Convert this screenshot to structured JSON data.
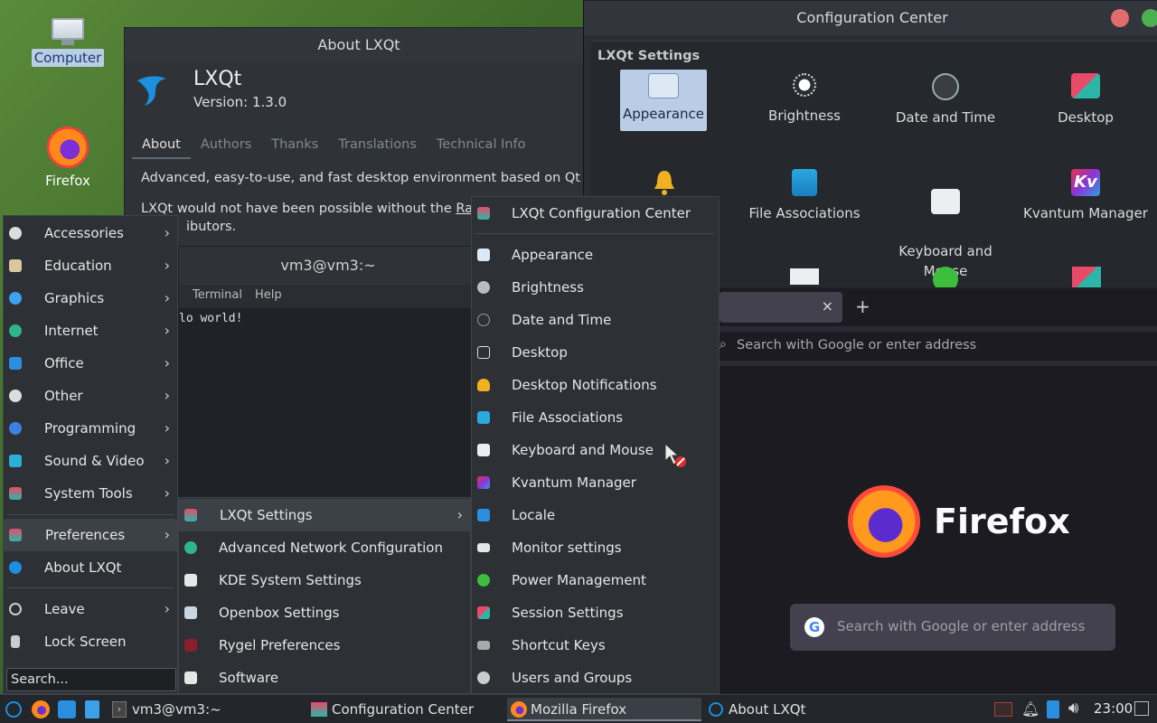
{
  "desktop": {
    "icons": [
      {
        "label": "Computer"
      },
      {
        "label": "Firefox"
      }
    ]
  },
  "about_window": {
    "title": "About LXQt",
    "app_name": "LXQt",
    "version": "Version: 1.3.0",
    "tabs": [
      "About",
      "Authors",
      "Thanks",
      "Translations",
      "Technical Info"
    ],
    "description": "Advanced, easy-to-use, and fast desktop environment based on Qt tec",
    "credits_line1_pre": "LXQt would not have been possible without the ",
    "credits_link": "Razo",
    "credits_line2": "ibutors."
  },
  "config_center": {
    "title": "Configuration Center",
    "section": "LXQt Settings",
    "items": [
      {
        "label": "Appearance"
      },
      {
        "label": "Brightness"
      },
      {
        "label": "Date and Time"
      },
      {
        "label": "Desktop"
      },
      {
        "label": "File Associations"
      },
      {
        "label": "Keyboard and\nMouse"
      },
      {
        "label": "Kvantum Manager"
      }
    ]
  },
  "terminal": {
    "title": "vm3@vm3:~",
    "menu": [
      "Terminal",
      "Help"
    ],
    "output": "lo world!"
  },
  "firefox": {
    "address_placeholder": "Search with Google or enter address",
    "brand": "Firefox",
    "search_placeholder": "Search with Google or enter address",
    "new_tab": "+",
    "close_tab": "×"
  },
  "app_menu": {
    "categories": [
      {
        "label": "Accessories"
      },
      {
        "label": "Education"
      },
      {
        "label": "Graphics"
      },
      {
        "label": "Internet"
      },
      {
        "label": "Office"
      },
      {
        "label": "Other"
      },
      {
        "label": "Programming"
      },
      {
        "label": "Sound & Video"
      },
      {
        "label": "System Tools"
      }
    ],
    "preferences": "Preferences",
    "about": "About LXQt",
    "leave": "Leave",
    "lock": "Lock Screen",
    "search_placeholder": "Search..."
  },
  "preferences_menu": {
    "items": [
      {
        "label": "LXQt Settings"
      },
      {
        "label": "Advanced Network Configuration"
      },
      {
        "label": "KDE System Settings"
      },
      {
        "label": "Openbox Settings"
      },
      {
        "label": "Rygel Preferences"
      },
      {
        "label": "Software"
      }
    ]
  },
  "lxqt_settings_menu": {
    "header": "LXQt Configuration Center",
    "items": [
      {
        "label": "Appearance"
      },
      {
        "label": "Brightness"
      },
      {
        "label": "Date and Time"
      },
      {
        "label": "Desktop"
      },
      {
        "label": "Desktop Notifications"
      },
      {
        "label": "File Associations"
      },
      {
        "label": "Keyboard and Mouse"
      },
      {
        "label": "Kvantum Manager"
      },
      {
        "label": "Locale"
      },
      {
        "label": "Monitor settings"
      },
      {
        "label": "Power Management"
      },
      {
        "label": "Session Settings"
      },
      {
        "label": "Shortcut Keys"
      },
      {
        "label": "Users and Groups"
      }
    ]
  },
  "taskbar": {
    "tasks": [
      {
        "label": "vm3@vm3:~"
      },
      {
        "label": "Configuration Center"
      },
      {
        "label": "Mozilla Firefox"
      },
      {
        "label": "About LXQt"
      }
    ],
    "clock": "23:00"
  },
  "colors": {
    "menu_bg": "#2d3035",
    "highlight": "#3c4148",
    "selected_item": "#b9cde6"
  }
}
